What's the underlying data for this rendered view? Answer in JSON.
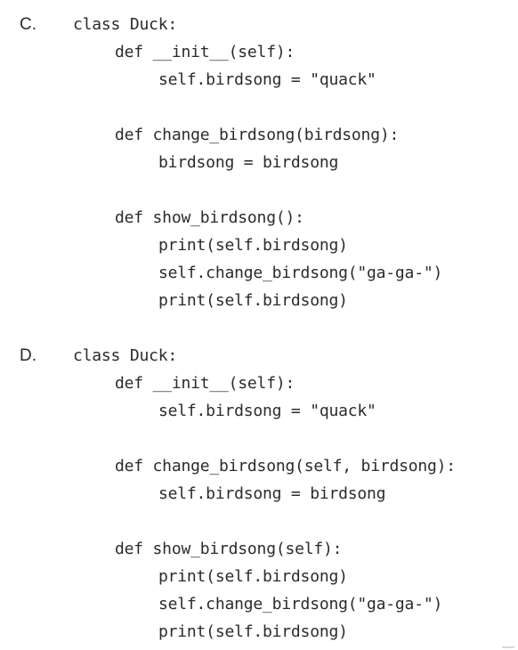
{
  "options": [
    {
      "letter": "C.",
      "lines": [
        "class Duck:",
        "def __init__(self):",
        "self.birdsong = \"quack\"",
        "def change_birdsong(birdsong):",
        "birdsong = birdsong",
        "def show_birdsong():",
        "print(self.birdsong)",
        "self.change_birdsong(\"ga-ga-\")",
        "print(self.birdsong)"
      ]
    },
    {
      "letter": "D.",
      "lines": [
        "class Duck:",
        "def __init__(self):",
        "self.birdsong = \"quack\"",
        "def change_birdsong(self, birdsong):",
        "self.birdsong = birdsong",
        "def show_birdsong(self):",
        "print(self.birdsong)",
        "self.change_birdsong(\"ga-ga-\")",
        "print(self.birdsong)"
      ]
    }
  ]
}
